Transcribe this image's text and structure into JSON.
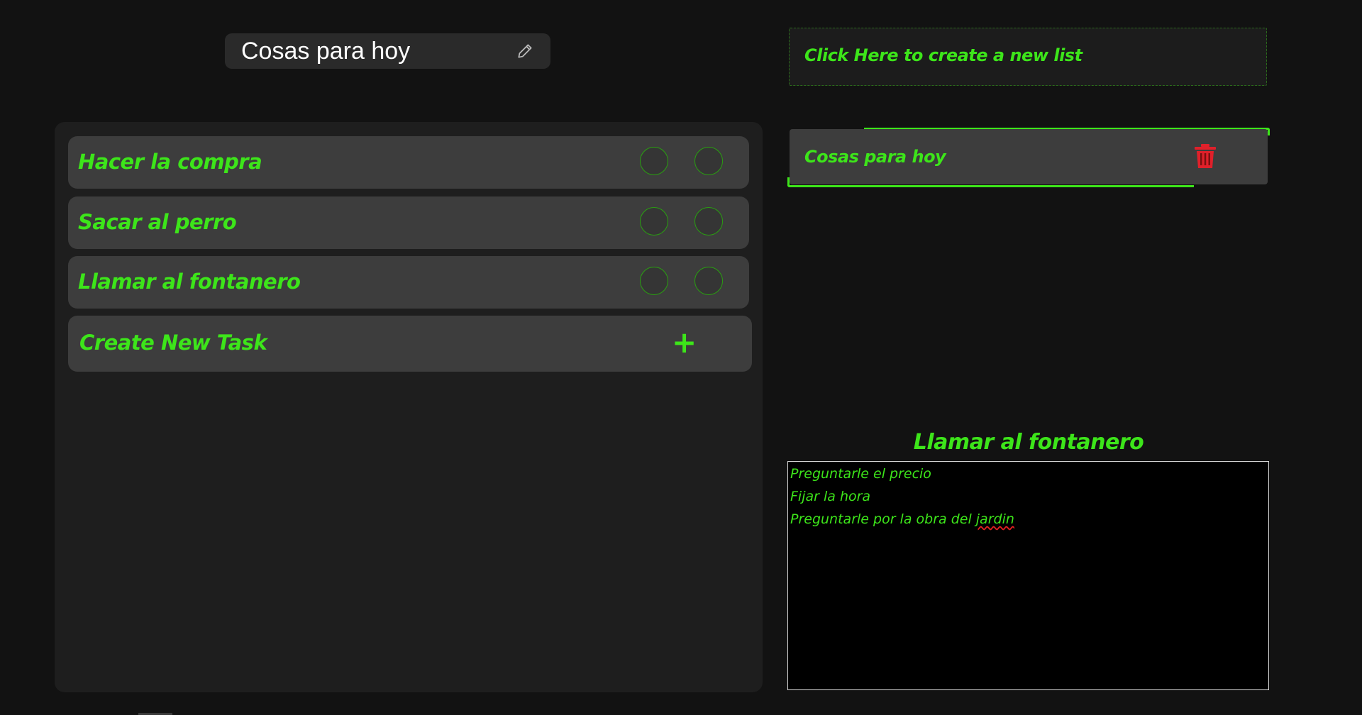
{
  "header": {
    "list_title": "Cosas para hoy"
  },
  "tasks": [
    {
      "label": "Hacer la compra"
    },
    {
      "label": "Sacar al perro"
    },
    {
      "label": "Llamar al fontanero"
    }
  ],
  "new_task": {
    "label": "Create New Task",
    "icon": "plus-icon"
  },
  "lists_panel": {
    "create_label": "Click Here to create a new list",
    "items": [
      {
        "label": "Cosas para hoy",
        "icon": "trash-icon"
      }
    ]
  },
  "detail": {
    "title": "Llamar al fontanero",
    "notes_before": "Preguntarle el precio",
    "note_lines": [
      "Preguntarle el precio",
      "Fijar la hora",
      "Preguntarle por la obra del"
    ],
    "misspelled_word": "jardin"
  },
  "colors": {
    "accent": "#3de51a",
    "background": "#121212",
    "panel": "#1e1e1e",
    "card": "#3d3d3d",
    "danger": "#e0202a"
  }
}
